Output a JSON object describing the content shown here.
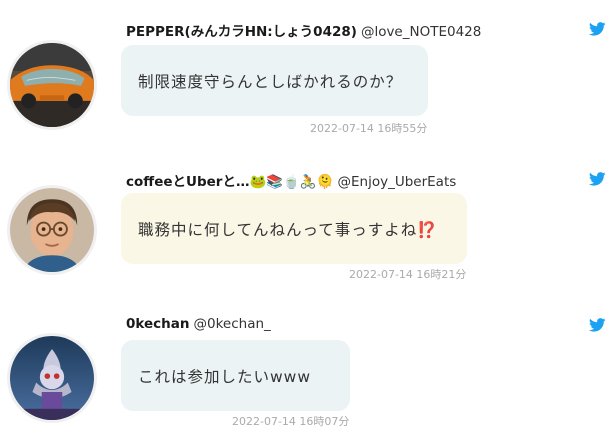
{
  "tweets": [
    {
      "username": "PEPPER(みんカラHN:しょう0428)",
      "handle": "@love_NOTE0428",
      "text": "制限速度守らんとしばかれるのか？",
      "timestamp": "2022-07-14 16時55分",
      "bubble_color": "#ebf3f5"
    },
    {
      "username": "coffeeとUberと…🐸📚🍵🚴🫠",
      "handle": "@Enjoy_UberEats",
      "text": "職務中に何してんねんって事っすよね⁉️",
      "timestamp": "2022-07-14 16時21分",
      "bubble_color": "#faf7e6"
    },
    {
      "username": "0kechan",
      "handle": "@0kechan_",
      "text": "これは参加したいwww",
      "timestamp": "2022-07-14 16時07分",
      "bubble_color": "#ebf3f5"
    }
  ],
  "colors": {
    "twitter_blue": "#1da1f2",
    "timestamp_gray": "#aaaaaa"
  },
  "icons": {
    "network": "twitter-bird-icon"
  }
}
